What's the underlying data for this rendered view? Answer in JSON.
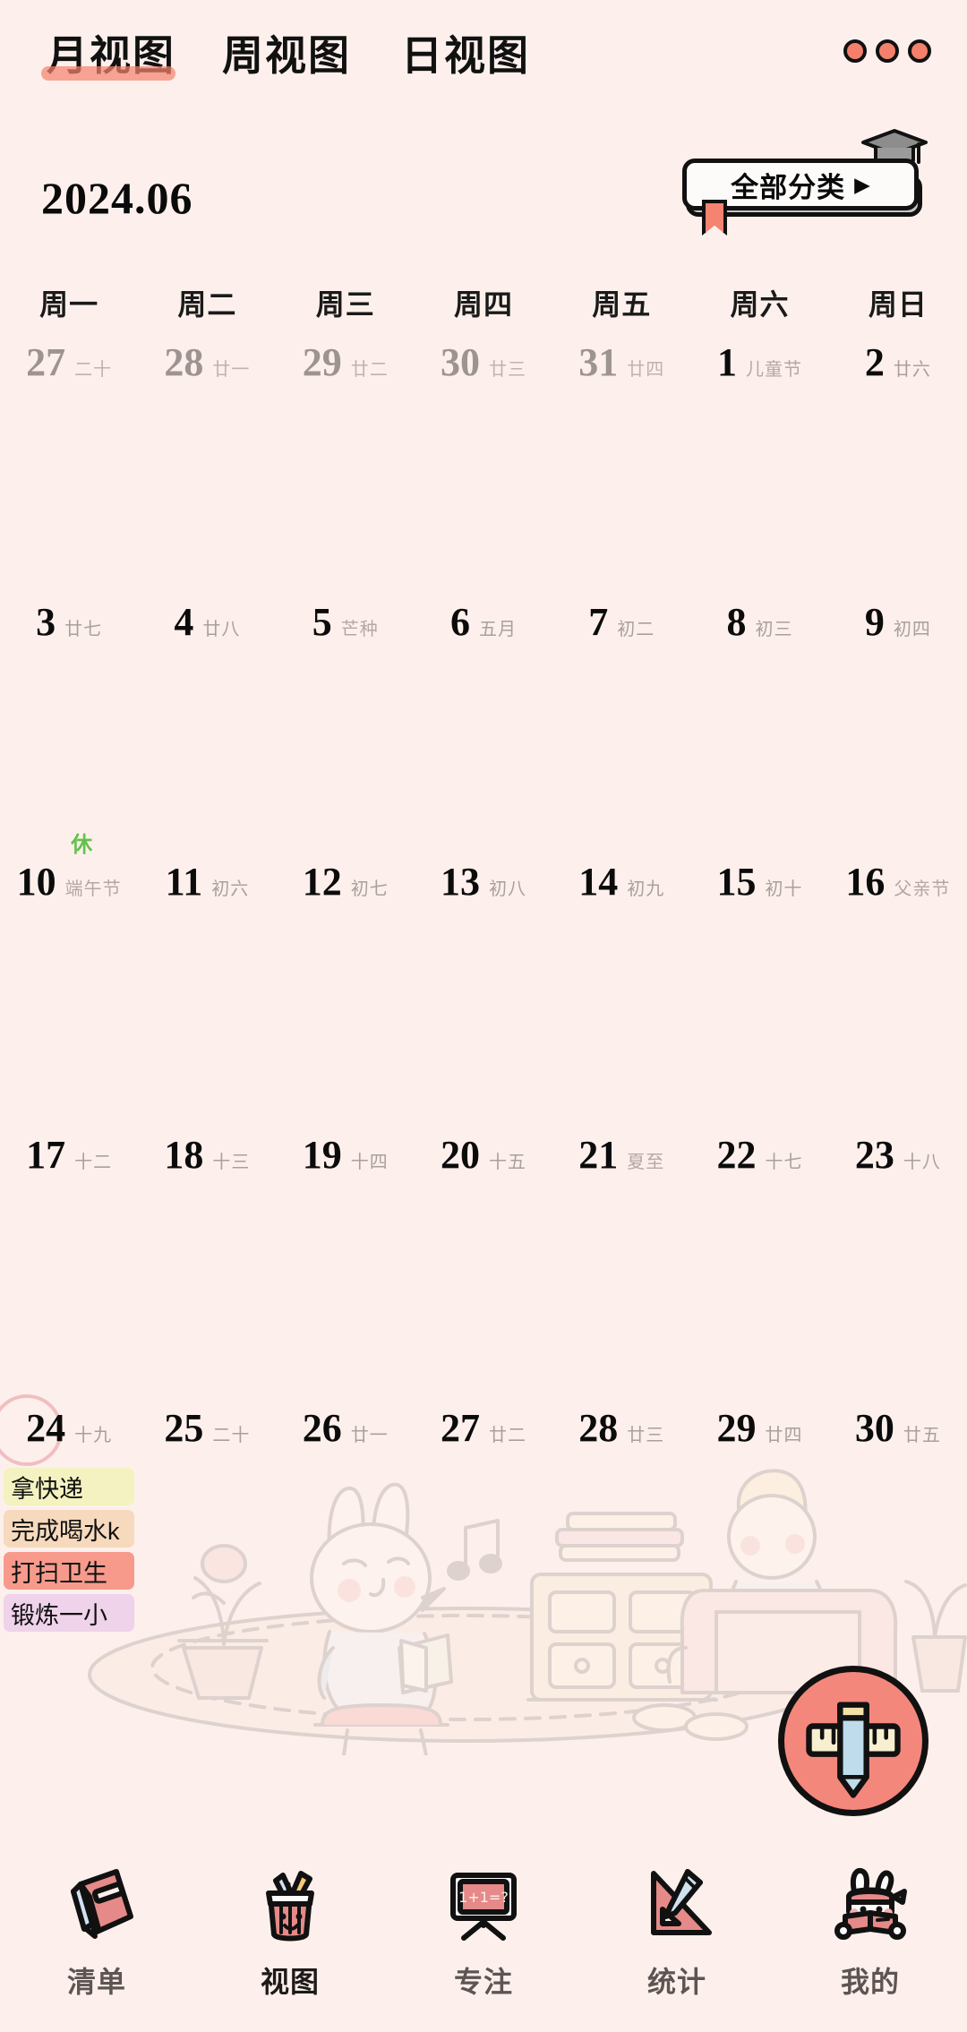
{
  "app": {
    "background_color": "#fdf0ec",
    "accent_color": "#f4836f"
  },
  "topnav": {
    "tabs": [
      {
        "label": "月视图",
        "active": true
      },
      {
        "label": "周视图",
        "active": false
      },
      {
        "label": "日视图",
        "active": false
      }
    ],
    "more_menu": {
      "name": "three-dots-menu",
      "dot_color": "#f4806c",
      "count": 3
    }
  },
  "header": {
    "month_label": "2024.06",
    "category_button": {
      "label": "全部分类",
      "arrow": "▶",
      "icon": "graduation-cap-icon",
      "bookmark_color": "#f4836f"
    }
  },
  "weekdays": [
    "周一",
    "周二",
    "周三",
    "周四",
    "周五",
    "周六",
    "周日"
  ],
  "calendar": {
    "weeks": [
      [
        {
          "day": "27",
          "lunar": "二十",
          "out": true
        },
        {
          "day": "28",
          "lunar": "廿一",
          "out": true
        },
        {
          "day": "29",
          "lunar": "廿二",
          "out": true
        },
        {
          "day": "30",
          "lunar": "廿三",
          "out": true
        },
        {
          "day": "31",
          "lunar": "廿四",
          "out": true
        },
        {
          "day": "1",
          "lunar": "儿童节",
          "festival": true
        },
        {
          "day": "2",
          "lunar": "廿六"
        }
      ],
      [
        {
          "day": "3",
          "lunar": "廿七"
        },
        {
          "day": "4",
          "lunar": "廿八"
        },
        {
          "day": "5",
          "lunar": "芒种",
          "festival": true
        },
        {
          "day": "6",
          "lunar": "五月"
        },
        {
          "day": "7",
          "lunar": "初二"
        },
        {
          "day": "8",
          "lunar": "初三"
        },
        {
          "day": "9",
          "lunar": "初四"
        }
      ],
      [
        {
          "day": "10",
          "lunar": "端午节",
          "festival": true,
          "rest_badge": "休"
        },
        {
          "day": "11",
          "lunar": "初六"
        },
        {
          "day": "12",
          "lunar": "初七"
        },
        {
          "day": "13",
          "lunar": "初八"
        },
        {
          "day": "14",
          "lunar": "初九"
        },
        {
          "day": "15",
          "lunar": "初十"
        },
        {
          "day": "16",
          "lunar": "父亲节",
          "festival": true
        }
      ],
      [
        {
          "day": "17",
          "lunar": "十二"
        },
        {
          "day": "18",
          "lunar": "十三"
        },
        {
          "day": "19",
          "lunar": "十四"
        },
        {
          "day": "20",
          "lunar": "十五"
        },
        {
          "day": "21",
          "lunar": "夏至",
          "festival": true
        },
        {
          "day": "22",
          "lunar": "十七"
        },
        {
          "day": "23",
          "lunar": "十八"
        }
      ],
      [
        {
          "day": "24",
          "lunar": "十九",
          "today": true,
          "tasks": [
            {
              "text": "拿快递",
              "color": "#f4f2c0"
            },
            {
              "text": "完成喝水k",
              "color": "#f7d9bd"
            },
            {
              "text": "打扫卫生",
              "color": "#f79a8c"
            },
            {
              "text": "锻炼一小",
              "color": "#eed3ea"
            }
          ]
        },
        {
          "day": "25",
          "lunar": "二十"
        },
        {
          "day": "26",
          "lunar": "廿一"
        },
        {
          "day": "27",
          "lunar": "廿二"
        },
        {
          "day": "28",
          "lunar": "廿三"
        },
        {
          "day": "29",
          "lunar": "廿四"
        },
        {
          "day": "30",
          "lunar": "廿五"
        }
      ]
    ]
  },
  "fab": {
    "name": "add-task-button",
    "icon": "pencil-ruler-plus-icon",
    "color": "#f4877b"
  },
  "bottomnav": {
    "items": [
      {
        "label": "清单",
        "icon": "notebook-icon",
        "active": false
      },
      {
        "label": "视图",
        "icon": "pencil-cup-icon",
        "active": true
      },
      {
        "label": "专注",
        "icon": "blackboard-icon",
        "active": false
      },
      {
        "label": "统计",
        "icon": "ruler-pencil-icon",
        "active": false
      },
      {
        "label": "我的",
        "icon": "bunny-reading-icon",
        "active": false
      }
    ]
  }
}
